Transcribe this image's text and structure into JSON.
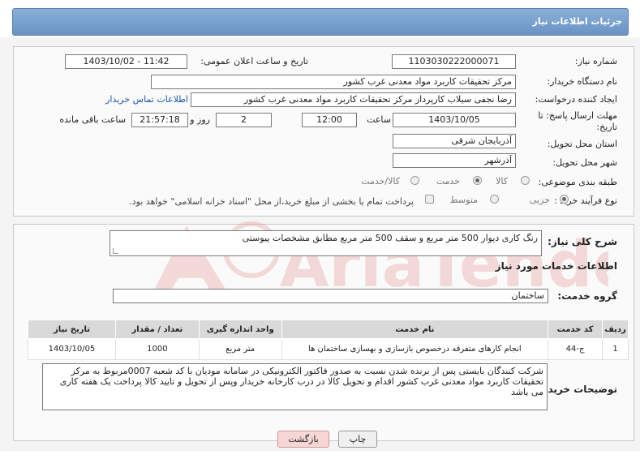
{
  "header": {
    "title": "جزئیات اطلاعات نیاز"
  },
  "form": {
    "need_number_label": "شماره نیاز:",
    "need_number": "1103030222000071",
    "announce_label": "تاریخ و ساعت اعلان عمومی:",
    "announce_value": "1403/10/02 - 11:42",
    "buyer_label": "نام دستگاه خریدار:",
    "buyer_value": "مرکز تحقیقات کاربرد مواد معدنی غرب کشور",
    "creator_label": "ایجاد کننده درخواست:",
    "creator_value": "رضا نجفی سیلاب کارپرداز مرکز تحقیقات کاربرد مواد معدنی غرب کشور",
    "contact_link": "اطلاعات تماس خریدار",
    "deadline_label": "مهلت ارسال پاسخ: تا تاریخ:",
    "deadline_date": "1403/10/05",
    "time_label": "ساعت",
    "deadline_time": "12:00",
    "days_value": "2",
    "days_label": "روز و",
    "remaining_time": "21:57:18",
    "remaining_label": "ساعت باقی مانده",
    "province_label": "استان محل تحویل:",
    "province_value": "آذربایجان شرقی",
    "city_label": "شهر محل تحویل:",
    "city_value": "آذرشهر",
    "category_label": "طبقه بندی موضوعی:",
    "category_options": [
      "کالا",
      "خدمت",
      "کالا/خدمت"
    ],
    "process_label": "نوع فرآیند خرید :",
    "process_options": [
      "جزیی",
      "متوسط"
    ],
    "payment_note": "پرداخت تمام یا بخشی از مبلغ خرید،از محل \"اسناد خزانه اسلامی\" خواهد بود."
  },
  "details": {
    "description_label": "شرح کلی نیاز:",
    "description_value": "رنگ کاری دیوار 500 متر مربع و سقف 500 متر مربع مطابق مشخصات پیوستی",
    "services_title": "اطلاعات خدمات مورد نیاز",
    "group_label": "گروه خدمت:",
    "group_value": "ساختمان",
    "table": {
      "headers": [
        "ردیف",
        "کد خدمت",
        "نام خدمت",
        "واحد اندازه گیری",
        "تعداد / مقدار",
        "تاریخ نیاز"
      ],
      "rows": [
        [
          "1",
          "ج-44",
          "انجام کارهای متفرقه درخصوص بازسازی و بهسازی ساختمان ها",
          "متر مربع",
          "1000",
          "1403/10/05"
        ]
      ]
    },
    "buyer_notes_label": "توضیحات خریدار:",
    "buyer_notes_value": "شرکت کنندگان بایستی پس از برنده شدن نسبت به صدور فاکتور الکترونیکی در سامانه مودیان با کد شعبه 0007مربوط به مرکز تحقیقات کاربرد مواد معدنی غرب کشور اقدام و تحویل کالا در درب کارخانه خریدار  وپس از تحویل و تایید کالا پرداخت یک هفته کاری می باشد"
  },
  "buttons": {
    "print": "چاپ",
    "back": "بازگشت"
  },
  "watermark": {
    "brand": "AriaTender.net"
  },
  "colors": {
    "header": "#6a93c4",
    "link": "#1a56b0",
    "back_button": "#f7d6d6",
    "watermark": "#f0b8b8"
  }
}
